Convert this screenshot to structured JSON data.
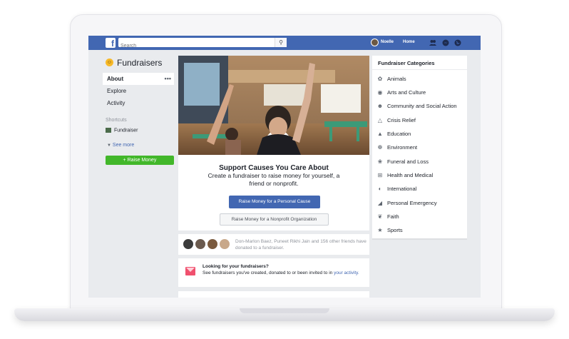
{
  "topbar": {
    "logo": "f",
    "search_placeholder": "Search",
    "user_name": "Noelle",
    "home_label": "Home"
  },
  "sidebar": {
    "title": "Fundraisers",
    "nav": [
      "About",
      "Explore",
      "Activity"
    ],
    "more_icon": "•••",
    "shortcuts_heading": "Shortcuts",
    "shortcut_item": "Fundraiser",
    "see_more": "See more",
    "raise_button": "+ Raise Money"
  },
  "main": {
    "heading": "Support Causes You Care About",
    "subheading": "Create a fundraiser to raise money for yourself, a friend or nonprofit.",
    "personal_button": "Raise Money for a Personal Cause",
    "nonprofit_button": "Raise Money for a Nonprofit Organization",
    "friends_text": "Don-Marlon Baez, Puneet Rikhi Jain and 156 other friends have donated to a fundraiser.",
    "looking_title": "Looking for your fundraisers?",
    "looking_text": "See fundraisers you've created, donated to or been invited to in ",
    "looking_link": "your activity."
  },
  "categories": {
    "heading": "Fundraiser Categories",
    "items": [
      {
        "label": "Animals",
        "icon": "paw-icon"
      },
      {
        "label": "Arts and Culture",
        "icon": "palette-icon"
      },
      {
        "label": "Community and Social Action",
        "icon": "people-icon"
      },
      {
        "label": "Crisis Relief",
        "icon": "warning-icon"
      },
      {
        "label": "Education",
        "icon": "graduation-cap-icon"
      },
      {
        "label": "Environment",
        "icon": "leaf-icon"
      },
      {
        "label": "Funeral and Loss",
        "icon": "flower-icon"
      },
      {
        "label": "Health and Medical",
        "icon": "medical-icon"
      },
      {
        "label": "International",
        "icon": "globe-icon"
      },
      {
        "label": "Personal Emergency",
        "icon": "megaphone-icon"
      },
      {
        "label": "Faith",
        "icon": "hands-icon"
      },
      {
        "label": "Sports",
        "icon": "trophy-icon"
      }
    ]
  },
  "colors": {
    "brand_blue": "#4267b2",
    "raise_green": "#42b72a",
    "page_bg": "#e9ebee"
  }
}
